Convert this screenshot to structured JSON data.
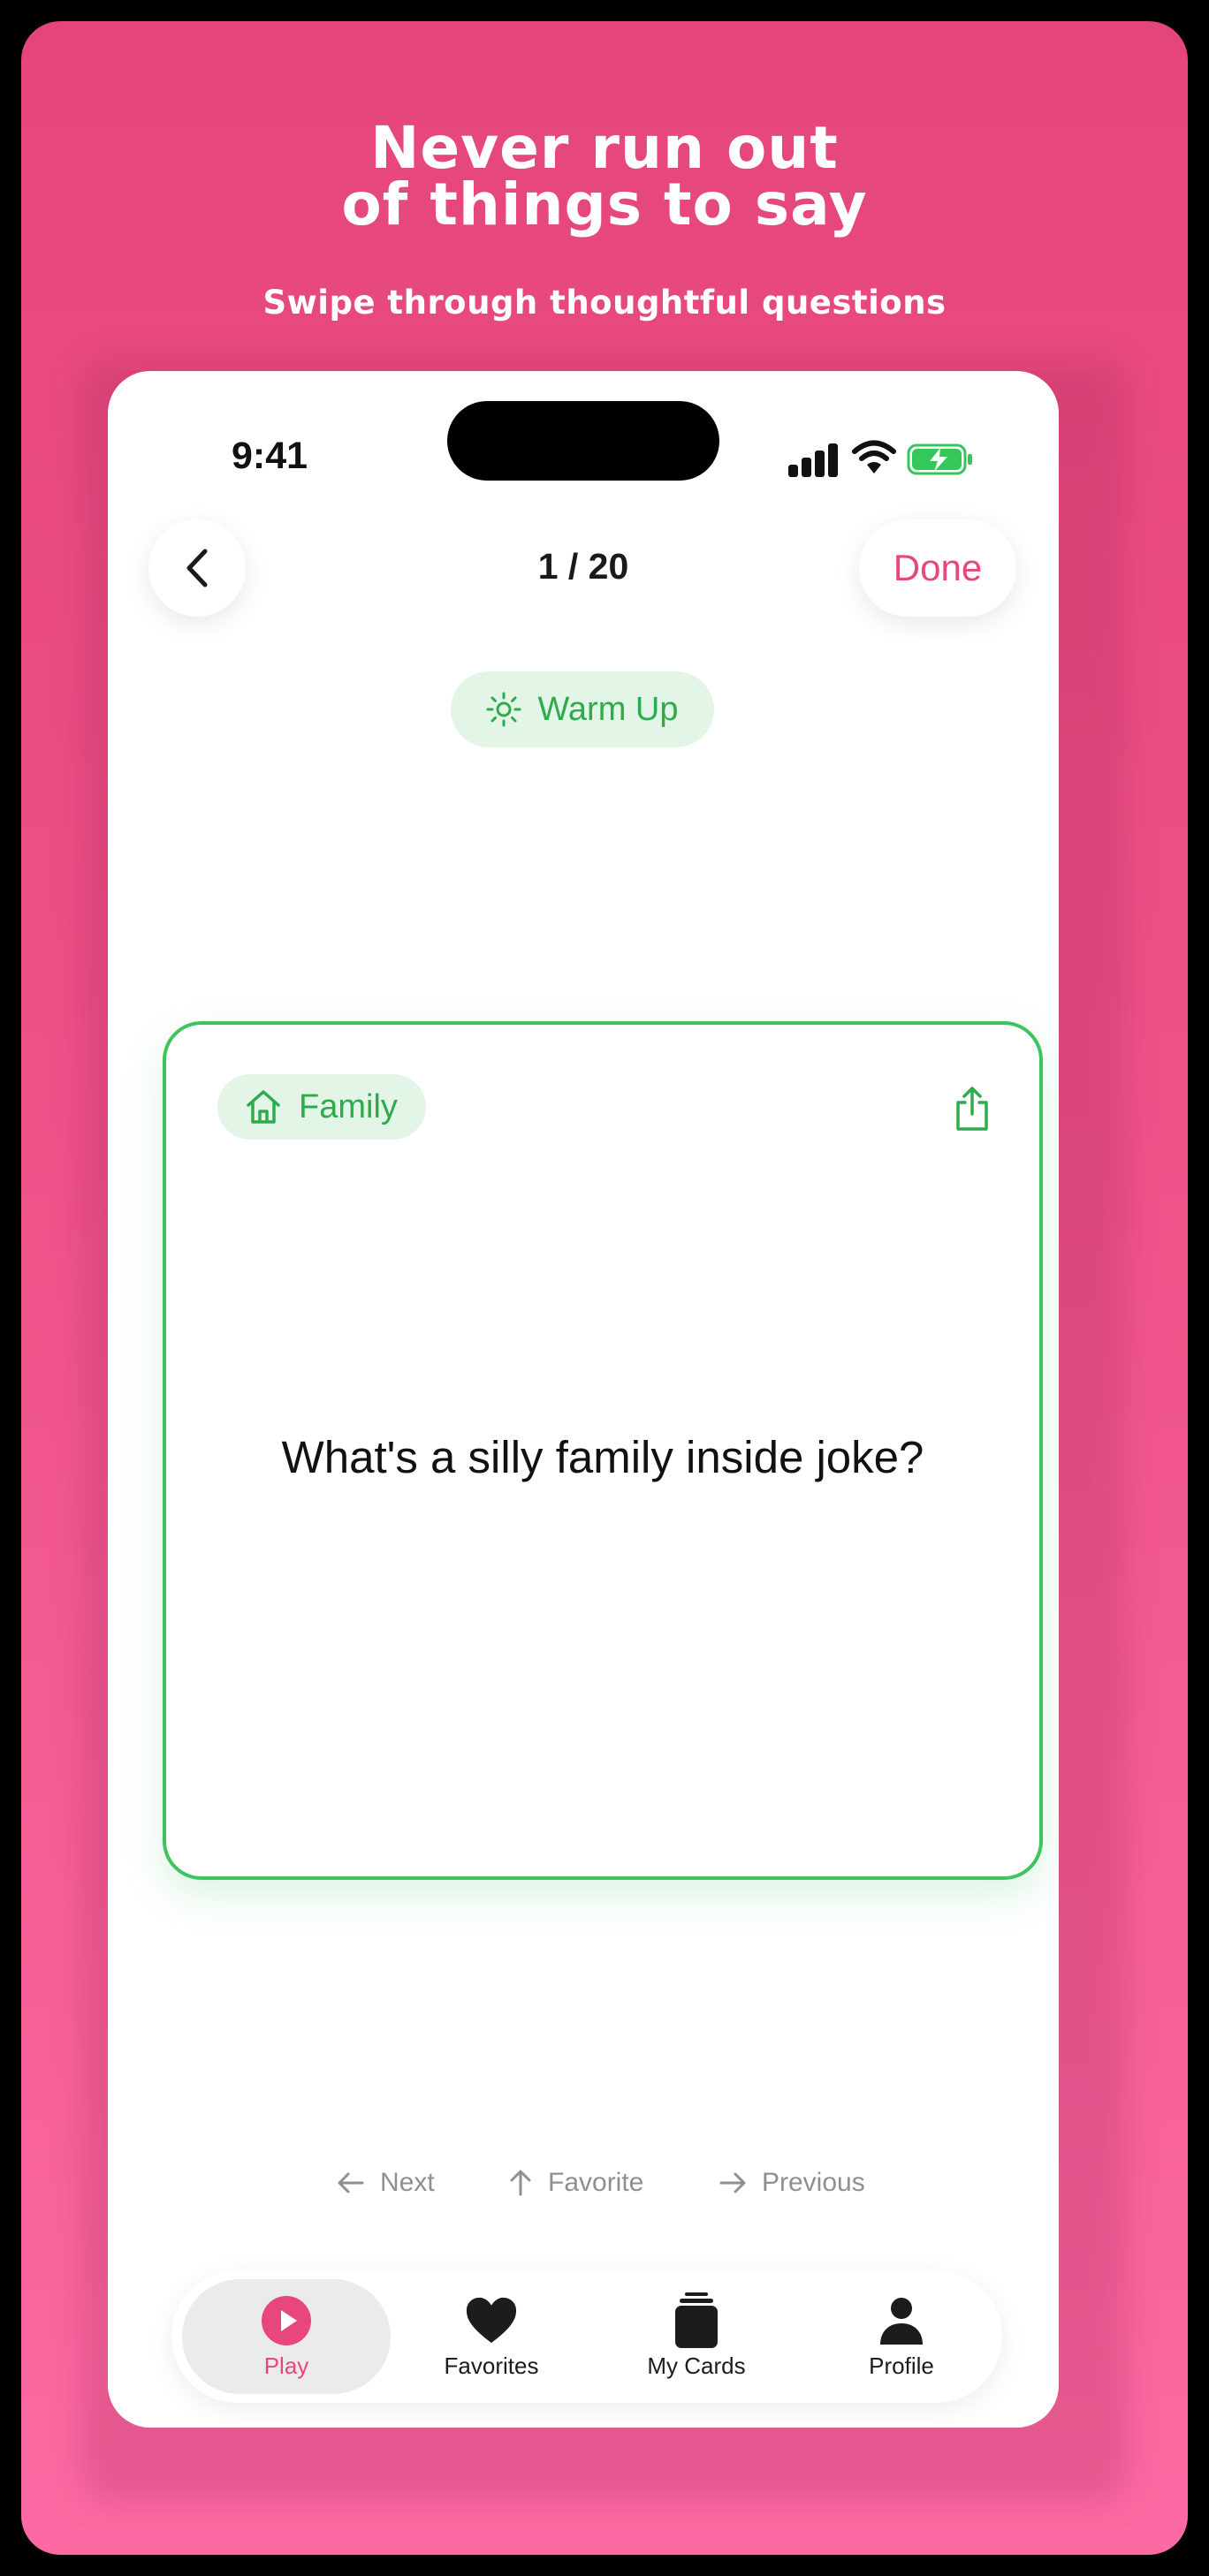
{
  "poster": {
    "headline_line1": "Never run out",
    "headline_line2": "of things to say",
    "subheadline": "Swipe through thoughtful questions"
  },
  "status_bar": {
    "time": "9:41"
  },
  "nav": {
    "counter": "1 / 20",
    "done_label": "Done"
  },
  "deck": {
    "label": "Warm Up"
  },
  "card": {
    "category": "Family",
    "question": "What's a silly family inside joke?"
  },
  "hints": {
    "next": "Next",
    "favorite": "Favorite",
    "previous": "Previous"
  },
  "tabs": [
    {
      "label": "Play",
      "icon": "play-circle-icon",
      "active": true
    },
    {
      "label": "Favorites",
      "icon": "heart-icon",
      "active": false
    },
    {
      "label": "My Cards",
      "icon": "card-stack-icon",
      "active": false
    },
    {
      "label": "Profile",
      "icon": "person-icon",
      "active": false
    }
  ],
  "colors": {
    "brand_pink": "#e8467f",
    "accent_green": "#2eab4c",
    "card_border_green": "#3ec45c",
    "battery_green": "#34c759"
  }
}
